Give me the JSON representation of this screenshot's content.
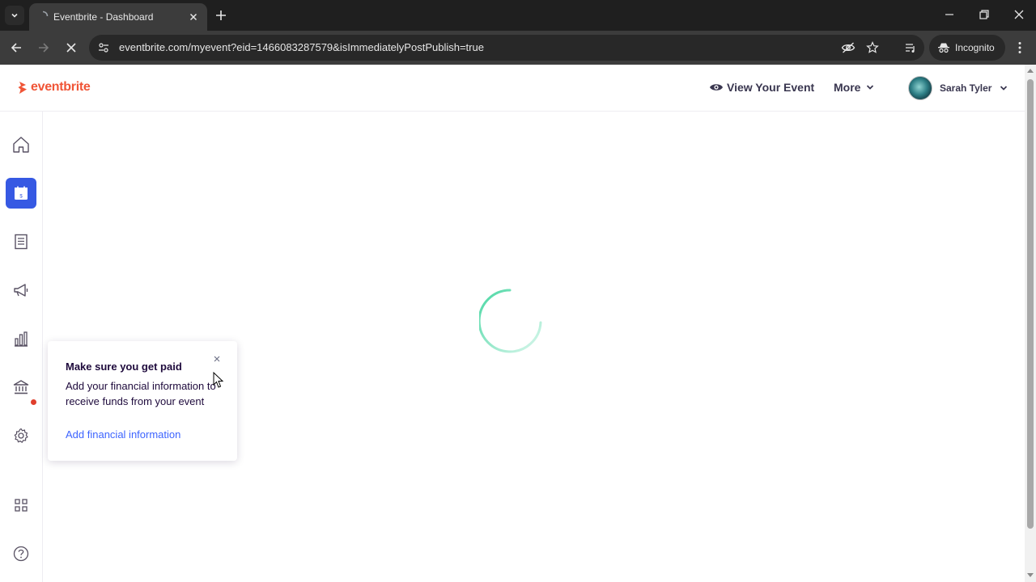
{
  "browser": {
    "tab_title": "Eventbrite - Dashboard",
    "url": "eventbrite.com/myevent?eid=1466083287579&isImmediatelyPostPublish=true",
    "incognito_label": "Incognito"
  },
  "header": {
    "logo_text": "eventbrite",
    "view_event_label": "View Your Event",
    "more_label": "More",
    "user_name": "Sarah Tyler"
  },
  "sidebar": {
    "items": [
      {
        "icon": "home-icon"
      },
      {
        "icon": "calendar-icon",
        "active": true
      },
      {
        "icon": "orders-list-icon"
      },
      {
        "icon": "megaphone-icon"
      },
      {
        "icon": "bar-chart-icon"
      },
      {
        "icon": "bank-icon",
        "notification": true
      },
      {
        "icon": "gear-icon"
      },
      {
        "icon": "apps-grid-icon"
      },
      {
        "icon": "help-icon"
      }
    ]
  },
  "popup": {
    "title": "Make sure you get paid",
    "body": "Add your financial information to receive funds from your event",
    "link": "Add financial information"
  },
  "colors": {
    "brand": "#f05537",
    "active_nav": "#3659e3",
    "link": "#3d64ff",
    "spinner": "#49d7a3"
  }
}
